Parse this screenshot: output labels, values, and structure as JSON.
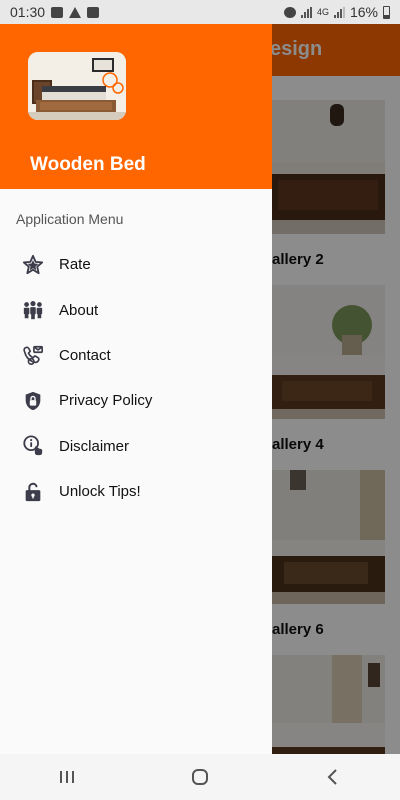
{
  "status_bar": {
    "time": "01:30",
    "network_label": "4G",
    "battery": "16%"
  },
  "background_app": {
    "title_fragment": "esign",
    "gallery_labels": [
      "allery 2",
      "allery 4",
      "allery 6"
    ]
  },
  "drawer": {
    "app_name": "Wooden Bed",
    "menu_heading": "Application Menu",
    "items": [
      {
        "label": "Rate",
        "icon": "star-icon"
      },
      {
        "label": "About",
        "icon": "people-icon"
      },
      {
        "label": "Contact",
        "icon": "contact-icon"
      },
      {
        "label": "Privacy Policy",
        "icon": "shield-lock-icon"
      },
      {
        "label": "Disclaimer",
        "icon": "info-hand-icon"
      },
      {
        "label": "Unlock Tips!",
        "icon": "unlock-icon"
      }
    ]
  },
  "colors": {
    "accent": "#ff6600",
    "drawer_bg": "#fafafa",
    "icon": "#3c3c4a"
  },
  "nav_bar": {
    "buttons": [
      "recent-apps",
      "home",
      "back"
    ]
  }
}
